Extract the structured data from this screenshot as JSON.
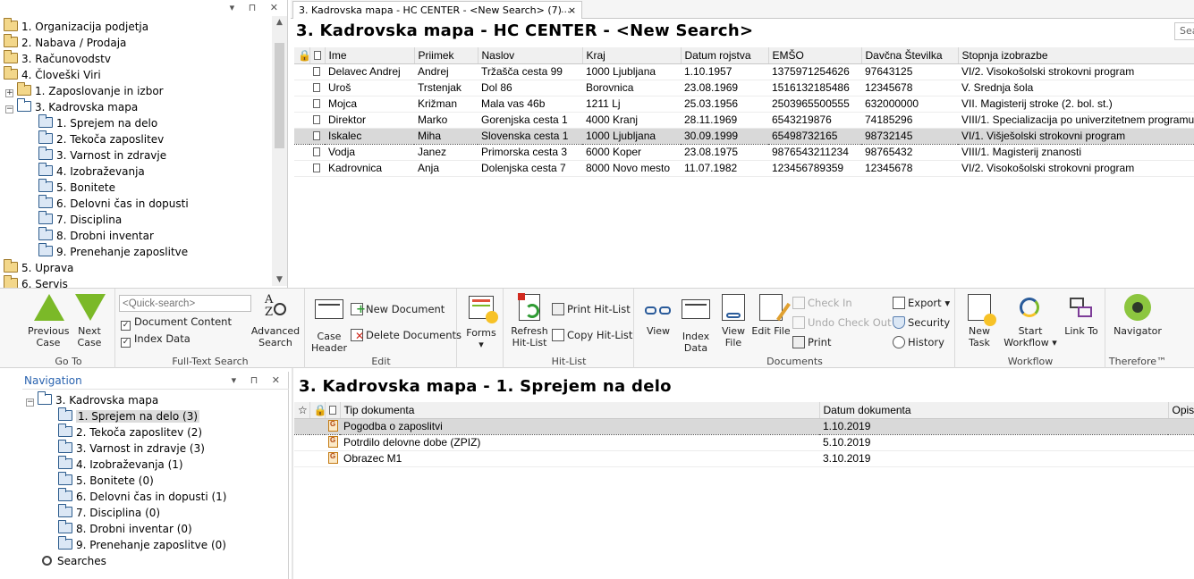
{
  "tree": {
    "items": [
      {
        "label": "1. Organizacija podjetja"
      },
      {
        "label": "2. Nabava / Prodaja"
      },
      {
        "label": "3. Računovodstv"
      },
      {
        "label": "4. Človeški Viri"
      },
      {
        "label": "1. Zaposlovanje in izbor",
        "expander": "+"
      },
      {
        "label": "3. Kadrovska mapa",
        "expander": "−"
      },
      {
        "label": "1. Sprejem na delo"
      },
      {
        "label": "2. Tekoča zaposlitev"
      },
      {
        "label": "3. Varnost in zdravje"
      },
      {
        "label": "4. Izobraževanja"
      },
      {
        "label": "5. Bonitete"
      },
      {
        "label": "6. Delovni čas in dopusti"
      },
      {
        "label": "7. Disciplina"
      },
      {
        "label": "8. Drobni inventar"
      },
      {
        "label": "9. Prenehanje zaposlitve"
      },
      {
        "label": "5. Uprava"
      },
      {
        "label": "6. Servis"
      }
    ]
  },
  "result_tab": {
    "label": "3. Kadrovska mapa - HC CENTER - <New Search> (7)",
    "close": "×",
    "more": "..."
  },
  "result": {
    "title": "3. Kadrovska mapa - HC CENTER - <New Search>",
    "search_placeholder": "Sea",
    "columns": [
      "Ime",
      "Priimek",
      "Naslov",
      "Kraj",
      "Datum rojstva",
      "EMŠO",
      "Davčna Številka",
      "Stopnja izobrazbe"
    ],
    "rows": [
      [
        "Delavec Andrej",
        "Andrej",
        "Tržaščа cesta 99",
        "1000 Ljubljana",
        "1.10.1957",
        "1375971254626",
        "97643125",
        "VI/2. Visokošolski strokovni program"
      ],
      [
        "Uroš",
        "Trstenjak",
        "Dol 86",
        "Borovnica",
        "23.08.1969",
        "1516132185486",
        "12345678",
        "V. Srednja šola"
      ],
      [
        "Mojca",
        "Križman",
        "Mala vas 46b",
        "1211 Lj",
        "25.03.1956",
        "2503965500555",
        "632000000",
        "VII. Magisterij stroke (2. bol. st.)"
      ],
      [
        "Direktor",
        "Marko",
        "Gorenjska cesta 1",
        "4000 Kranj",
        "28.11.1969",
        "6543219876",
        "74185296",
        "VIII/1. Specializacija po univerzitetnem programu"
      ],
      [
        "Iskalec",
        "Miha",
        "Slovenska cesta 1",
        "1000 Ljubljana",
        "30.09.1999",
        "65498732165",
        "98732145",
        "VI/1. Višješolski strokovni program"
      ],
      [
        "Vodja",
        "Janez",
        "Primorska cesta 3",
        "6000 Koper",
        "23.08.1975",
        "9876543211234",
        "98765432",
        "VIII/1. Magisterij znanosti"
      ],
      [
        "Kadrovnica",
        "Anja",
        "Dolenjska cesta 7",
        "8000 Novo mesto",
        "11.07.1982",
        "123456789359",
        "12345678",
        "VI/2. Visokošolski strokovni program"
      ]
    ]
  },
  "ribbon": {
    "goto": {
      "label": "Go To",
      "prev": "Previous Case",
      "next": "Next Case"
    },
    "fulltext": {
      "label": "Full-Text Search",
      "quick_search_placeholder": "<Quick-search>",
      "doc_content": "Document Content",
      "index_data": "Index Data",
      "advanced": "Advanced Search"
    },
    "edit": {
      "label": "Edit",
      "case_header": "Case Header",
      "new_document": "New Document",
      "delete_documents": "Delete Documents"
    },
    "forms": {
      "label": "Forms"
    },
    "hitlist": {
      "label": "Hit-List",
      "refresh": "Refresh Hit-List",
      "print": "Print Hit-List",
      "copy": "Copy Hit-List"
    },
    "documents": {
      "label": "Documents",
      "view": "View",
      "index_data": "Index Data",
      "view_file": "View File",
      "edit_file": "Edit File",
      "check_in": "Check In",
      "undo_check_out": "Undo Check Out",
      "print": "Print",
      "export": "Export",
      "security": "Security",
      "history": "History"
    },
    "workflow": {
      "label": "Workflow",
      "new_task": "New Task",
      "start_workflow": "Start Workflow",
      "link_to": "Link To"
    },
    "therefore": {
      "label": "Therefore™",
      "navigator": "Navigator"
    }
  },
  "navigation": {
    "title": "Navigation",
    "root": "3. Kadrovska mapa",
    "items": [
      "1. Sprejem na delo (3)",
      "2. Tekoča zaposlitev (2)",
      "3. Varnost in zdravje (3)",
      "4. Izobraževanja (1)",
      "5. Bonitete (0)",
      "6. Delovni čas in dopusti (1)",
      "7. Disciplina (0)",
      "8. Drobni inventar (0)",
      "9. Prenehanje zaposlitve (0)"
    ],
    "searches": "Searches"
  },
  "documents": {
    "title": "3. Kadrovska mapa - 1. Sprejem na delo",
    "columns": [
      "Tip dokumenta",
      "Datum dokumenta",
      "Opis"
    ],
    "rows": [
      [
        "Pogodba o zaposlitvi",
        "1.10.2019"
      ],
      [
        "Potrdilo delovne dobe (ZPIZ)",
        "5.10.2019"
      ],
      [
        "Obrazec M1",
        "3.10.2019"
      ]
    ]
  },
  "colors": {
    "accent": "#7bb928",
    "selection": "#d9d9d9",
    "nav_title": "#2b64b0"
  }
}
